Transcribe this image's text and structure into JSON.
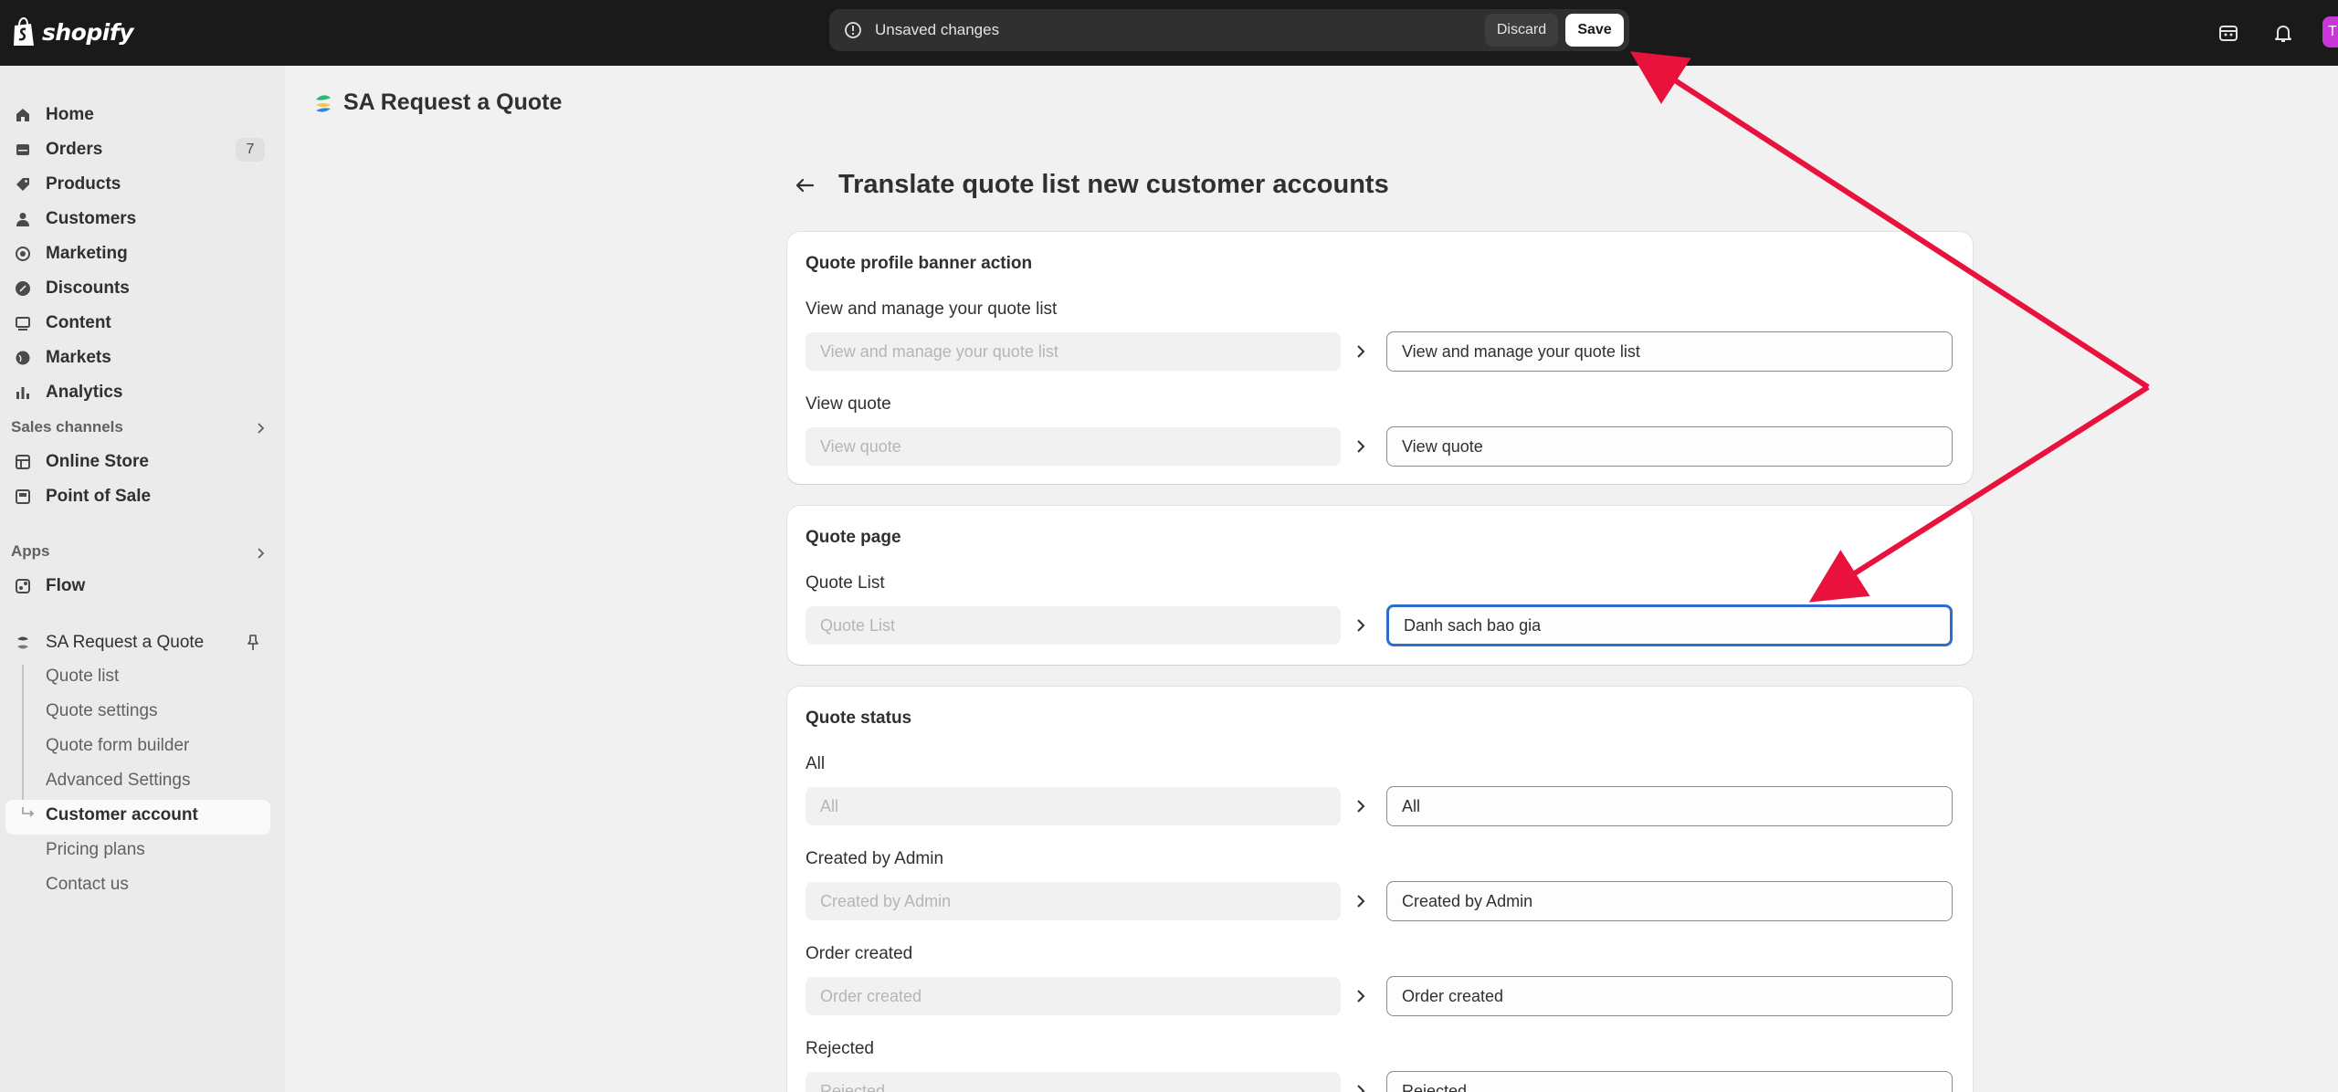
{
  "topbar": {
    "logo_text": "shopify",
    "unsaved_message": "Unsaved changes",
    "discard_label": "Discard",
    "save_label": "Save",
    "icons": [
      "store-icon",
      "bell-icon"
    ],
    "avatar_initial": "T"
  },
  "sidebar": {
    "items": [
      {
        "label": "Home",
        "icon": "home-icon"
      },
      {
        "label": "Orders",
        "icon": "orders-icon",
        "badge": "7"
      },
      {
        "label": "Products",
        "icon": "tag-icon"
      },
      {
        "label": "Customers",
        "icon": "person-icon"
      },
      {
        "label": "Marketing",
        "icon": "target-icon"
      },
      {
        "label": "Discounts",
        "icon": "discount-icon"
      },
      {
        "label": "Content",
        "icon": "content-icon"
      },
      {
        "label": "Markets",
        "icon": "globe-icon"
      },
      {
        "label": "Analytics",
        "icon": "bar-chart-icon"
      }
    ],
    "sales_channels_title": "Sales channels",
    "sales_channels": [
      {
        "label": "Online Store",
        "icon": "storefront-icon"
      },
      {
        "label": "Point of Sale",
        "icon": "pos-icon"
      }
    ],
    "apps_title": "Apps",
    "apps": [
      {
        "label": "Flow",
        "icon": "flow-icon"
      }
    ],
    "app_name": "SA Request a Quote",
    "app_subitems": [
      "Quote list",
      "Quote settings",
      "Quote form builder",
      "Advanced Settings",
      "Customer account",
      "Pricing plans",
      "Contact us"
    ],
    "active_subitem": "Customer account"
  },
  "page": {
    "app_title": "SA Request a Quote",
    "heading": "Translate quote list new customer accounts",
    "sections": [
      {
        "title": "Quote profile banner action",
        "fields": [
          {
            "label": "View and manage your quote list",
            "source": "View and manage your quote list",
            "value": "View and manage your quote list"
          },
          {
            "label": "View quote",
            "source": "View quote",
            "value": "View quote"
          }
        ]
      },
      {
        "title": "Quote page",
        "fields": [
          {
            "label": "Quote List",
            "source": "Quote List",
            "value": "Danh sach bao gia"
          }
        ]
      },
      {
        "title": "Quote status",
        "fields": [
          {
            "label": "All",
            "source": "All",
            "value": "All"
          },
          {
            "label": "Created by Admin",
            "source": "Created by Admin",
            "value": "Created by Admin"
          },
          {
            "label": "Order created",
            "source": "Order created",
            "value": "Order created"
          },
          {
            "label": "Rejected",
            "source": "Rejected",
            "value": "Rejected"
          }
        ]
      }
    ]
  },
  "colors": {
    "topbar": "#1a1a1a",
    "focus_ring": "#2c6ecb",
    "annotation_arrow": "#e8123c"
  }
}
